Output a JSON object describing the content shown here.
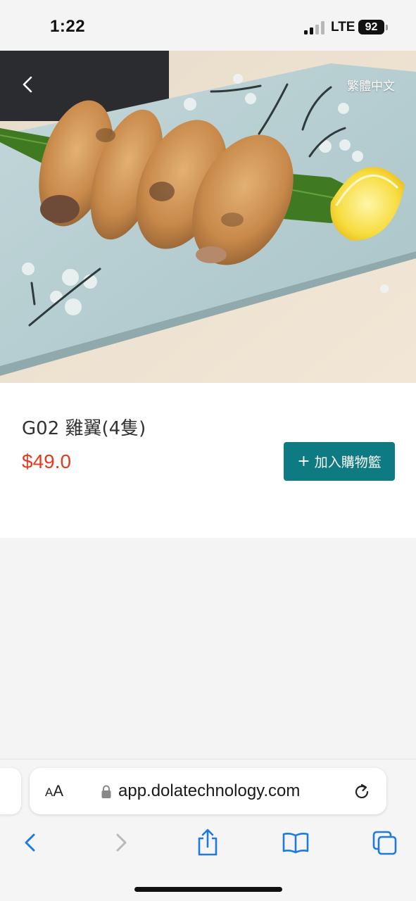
{
  "status_bar": {
    "time": "1:22",
    "network": "LTE",
    "battery": "92"
  },
  "header": {
    "language_toggle": "繁體中文",
    "back_icon": "chevron-left-icon"
  },
  "product": {
    "name": "G02 雞翼(4隻)",
    "price": "$49.0",
    "add_to_cart_label": "加入購物籃",
    "add_to_cart_plus": "+",
    "image_description_icon": "food-photo"
  },
  "browser": {
    "reader_label_big": "A",
    "reader_label_small": "A",
    "url": "app.dolatechnology.com",
    "icons": [
      "lock-icon",
      "reload-icon",
      "back-icon",
      "forward-icon",
      "share-icon",
      "bookmarks-icon",
      "tabs-icon"
    ]
  },
  "colors": {
    "accent": "#0e7a82",
    "price": "#e8391f",
    "ios_blue": "#1f7ae0"
  }
}
